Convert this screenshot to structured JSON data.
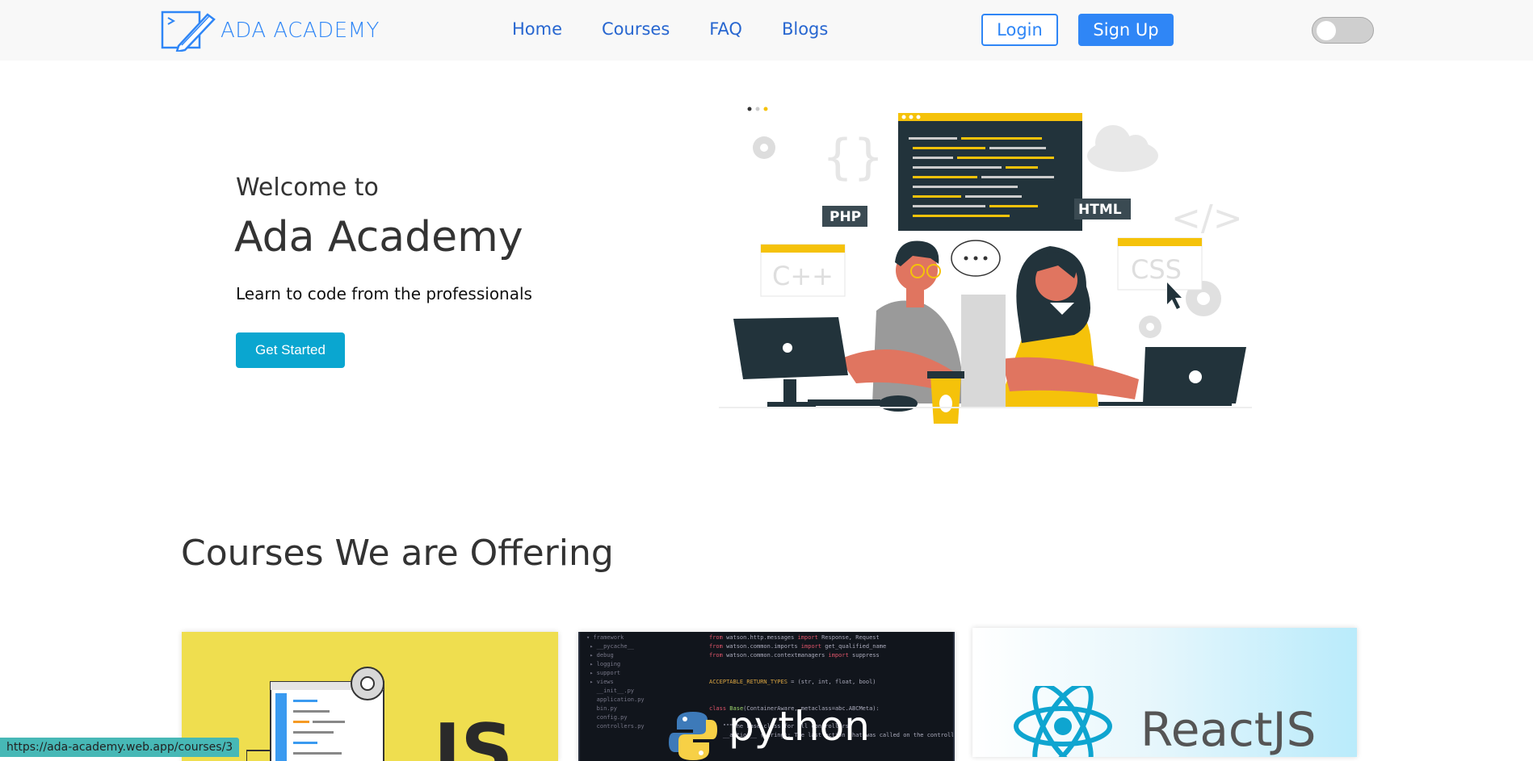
{
  "brand": {
    "name": "ADA ACADEMY"
  },
  "nav": {
    "links": [
      "Home",
      "Courses",
      "FAQ",
      "Blogs"
    ]
  },
  "auth": {
    "login": "Login",
    "signup": "Sign Up"
  },
  "hero": {
    "pre_title": "Welcome to",
    "title": "Ada Academy",
    "subtitle": "Learn to code from the professionals",
    "cta": "Get Started",
    "illustration_labels": {
      "php": "PHP",
      "html": "HTML",
      "cpp": "C++",
      "css": "CSS"
    }
  },
  "courses": {
    "title": "Courses We are Offering",
    "cards": [
      {
        "label": "JS"
      },
      {
        "label": "python"
      },
      {
        "label": "ReactJS"
      }
    ]
  },
  "status_bar": {
    "url": "https://ada-academy.web.app/courses/3"
  },
  "colors": {
    "primary": "#2f86f6",
    "cta": "#0aa6d0",
    "js_bg": "#efde4f",
    "python_bg": "#11151c"
  }
}
